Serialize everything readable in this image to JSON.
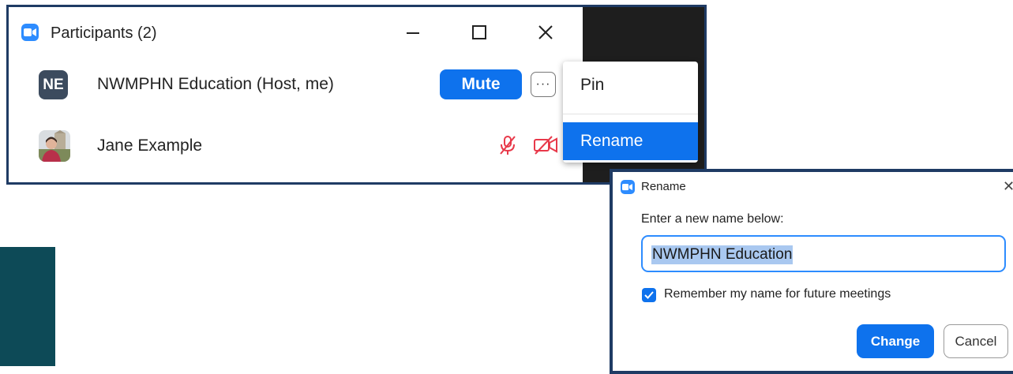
{
  "participants_window": {
    "title": "Participants (2)",
    "controls": {
      "minimize_icon": "minimize-icon",
      "maximize_icon": "maximize-icon",
      "close_icon": "close-icon"
    },
    "participants": [
      {
        "initials": "NE",
        "name": "NWMPHN Education (Host, me)",
        "mute_label": "Mute",
        "more_label": "···"
      },
      {
        "name": "Jane Example",
        "audio_status": "muted",
        "video_status": "off"
      }
    ]
  },
  "context_menu": {
    "items": [
      {
        "label": "Pin"
      },
      {
        "label": "Rename",
        "highlighted": true
      }
    ]
  },
  "rename_dialog": {
    "title": "Rename",
    "close_glyph": "✕",
    "prompt": "Enter a new name below:",
    "name_input": {
      "value": "NWMPHN Education",
      "selected": true
    },
    "remember_checkbox": {
      "label": "Remember my name for future meetings",
      "checked": true
    },
    "change_label": "Change",
    "cancel_label": "Cancel"
  },
  "colors": {
    "accent": "#0e72ed",
    "zoom_blue": "#2d8cff",
    "window_border": "#1f3b64",
    "muted_red": "#e8394a",
    "teal": "#0d4a57"
  }
}
